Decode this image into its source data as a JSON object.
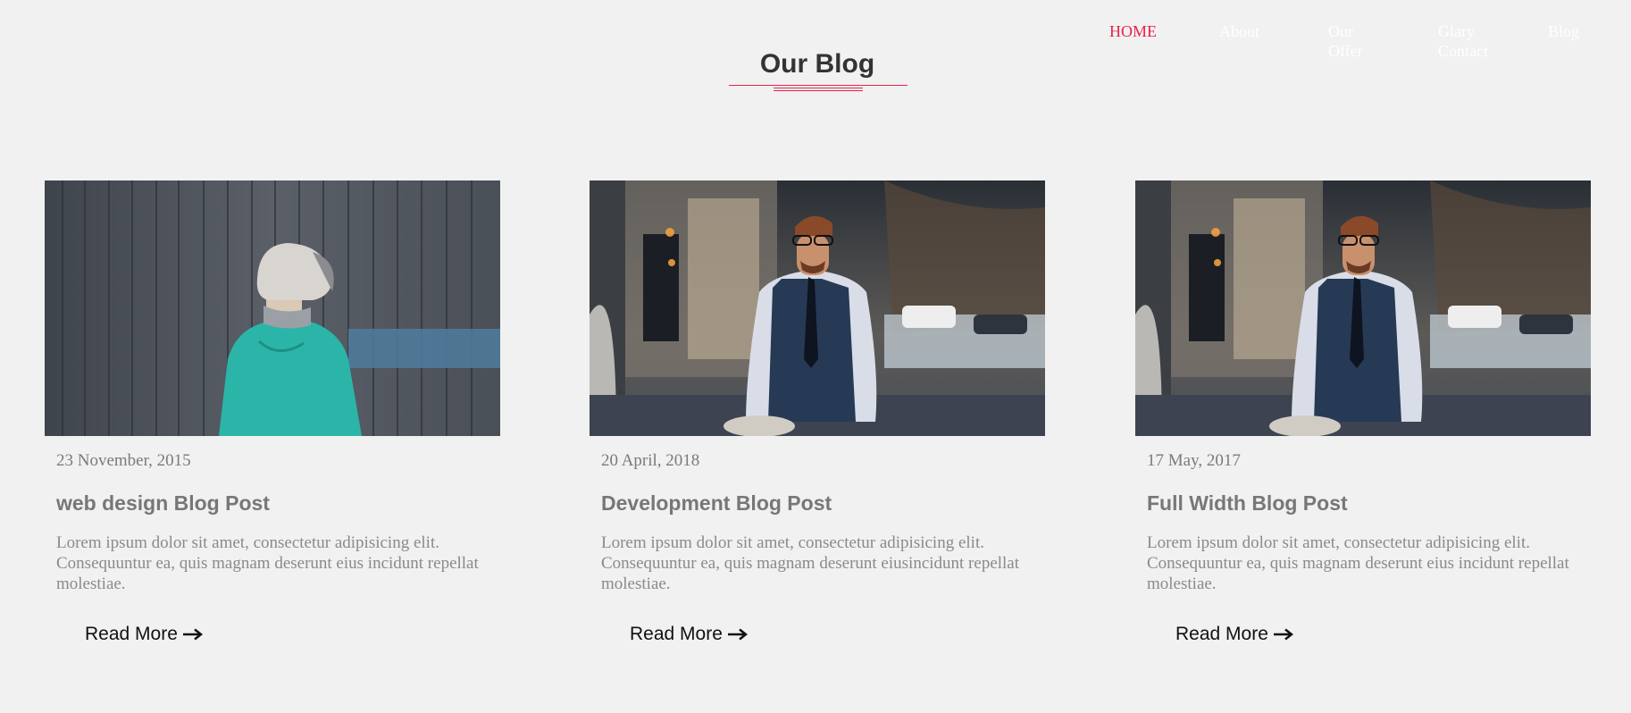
{
  "nav": {
    "items": [
      {
        "label": "HOME"
      },
      {
        "label": "About"
      },
      {
        "label": "Our Offer"
      },
      {
        "label": "Glary Contact"
      },
      {
        "label": "Blog"
      }
    ]
  },
  "header": {
    "title": "Our Blog"
  },
  "posts": [
    {
      "date": "23 November, 2015",
      "title": "web design Blog Post",
      "excerpt": "Lorem ipsum dolor sit amet, consectetur adipisicing elit. Consequuntur ea, quis magnam deserunt eius incidunt repellat molestiae.",
      "read_more": "Read More"
    },
    {
      "date": "20 April, 2018",
      "title": "Development Blog Post",
      "excerpt": "Lorem ipsum dolor sit amet, consectetur adipisicing elit. Consequuntur ea, quis magnam deserunt eiusincidunt repellat molestiae.",
      "read_more": "Read More"
    },
    {
      "date": "17 May, 2017",
      "title": "Full Width Blog Post",
      "excerpt": "Lorem ipsum dolor sit amet, consectetur adipisicing elit. Consequuntur ea, quis magnam deserunt eius incidunt repellat molestiae.",
      "read_more": "Read More"
    }
  ],
  "colors": {
    "accent": "#e8214a",
    "background": "#f1f1f1"
  }
}
